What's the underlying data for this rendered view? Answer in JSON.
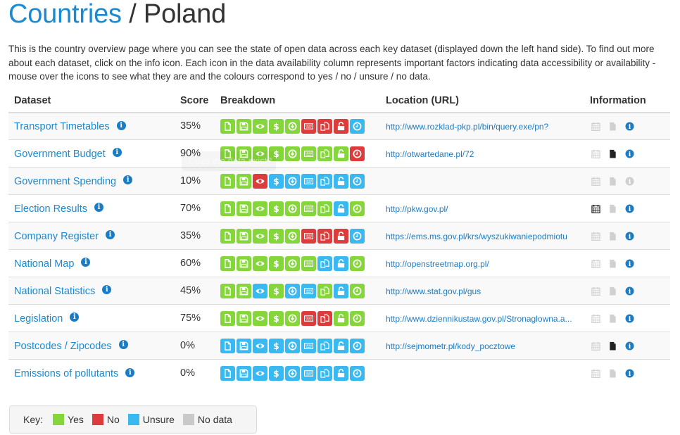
{
  "header": {
    "breadcrumb_link": "Countries",
    "separator": " / ",
    "country": "Poland"
  },
  "intro": "This is the country overview page where you can see the state of open data across each key dataset (displayed down the left hand side). To find out more about each dataset, click on the info icon. Each icon in the data availability column represents important factors indicating data accessibility or availability - mouse over the icons to see what they are and the colours correspond to yes / no / unsure / no data.",
  "columns": [
    "Dataset",
    "Score",
    "Breakdown",
    "Location (URL)",
    "Information"
  ],
  "breakdown_icons": [
    "file-icon",
    "save-icon",
    "eye-icon",
    "dollar-icon",
    "download-icon",
    "keyboard-icon",
    "copy-icon",
    "unlock-icon",
    "clock-icon"
  ],
  "colors": {
    "yes": "#85d63a",
    "no": "#dc3c3c",
    "unsure": "#38b9f2",
    "nodata": "#c9c9c9",
    "link": "#1b8ad1"
  },
  "rows": [
    {
      "name": "Transport Timetables",
      "score": "35%",
      "breakdown": [
        "g",
        "g",
        "g",
        "g",
        "g",
        "r",
        "r",
        "r",
        "b"
      ],
      "url": "http://www.rozklad-pkp.pl/bin/query.exe/pn?",
      "info": {
        "calendar": "off",
        "file": "off",
        "info": "on"
      }
    },
    {
      "name": "Government Budget",
      "score": "90%",
      "breakdown": [
        "g",
        "g",
        "g",
        "g",
        "g",
        "g",
        "g",
        "g",
        "r"
      ],
      "url": "http://otwartedane.pl/72",
      "info": {
        "calendar": "off",
        "file": "on",
        "info": "on"
      }
    },
    {
      "name": "Government Spending",
      "score": "10%",
      "breakdown": [
        "g",
        "g",
        "r",
        "b",
        "b",
        "b",
        "b",
        "b",
        "b"
      ],
      "url": "",
      "info": {
        "calendar": "off",
        "file": "off",
        "info": "off"
      }
    },
    {
      "name": "Election Results",
      "score": "70%",
      "breakdown": [
        "g",
        "g",
        "g",
        "g",
        "g",
        "g",
        "g",
        "b",
        "g"
      ],
      "url": "http://pkw.gov.pl/",
      "info": {
        "calendar": "on",
        "file": "off",
        "info": "on"
      }
    },
    {
      "name": "Company Register",
      "score": "35%",
      "breakdown": [
        "g",
        "g",
        "g",
        "g",
        "g",
        "r",
        "r",
        "r",
        "b"
      ],
      "url": "https://ems.ms.gov.pl/krs/wyszukiwaniepodmiotu",
      "info": {
        "calendar": "off",
        "file": "off",
        "info": "on"
      }
    },
    {
      "name": "National Map",
      "score": "60%",
      "breakdown": [
        "g",
        "g",
        "g",
        "g",
        "g",
        "g",
        "b",
        "b",
        "g"
      ],
      "url": "http://openstreetmap.org.pl/",
      "info": {
        "calendar": "off",
        "file": "off",
        "info": "on"
      }
    },
    {
      "name": "National Statistics",
      "score": "45%",
      "breakdown": [
        "g",
        "g",
        "b",
        "g",
        "b",
        "b",
        "g",
        "b",
        "g"
      ],
      "url": "http://www.stat.gov.pl/gus",
      "info": {
        "calendar": "off",
        "file": "off",
        "info": "on"
      }
    },
    {
      "name": "Legislation",
      "score": "75%",
      "breakdown": [
        "g",
        "g",
        "g",
        "g",
        "g",
        "r",
        "r",
        "g",
        "g"
      ],
      "url": "http://www.dziennikustaw.gov.pl/Stronaglowna.a...",
      "info": {
        "calendar": "off",
        "file": "off",
        "info": "on"
      }
    },
    {
      "name": "Postcodes / Zipcodes",
      "score": "0%",
      "breakdown": [
        "b",
        "b",
        "b",
        "b",
        "b",
        "b",
        "b",
        "b",
        "b"
      ],
      "url": "http://sejmometr.pl/kody_pocztowe",
      "info": {
        "calendar": "off",
        "file": "on",
        "info": "on"
      }
    },
    {
      "name": "Emissions of pollutants",
      "score": "0%",
      "breakdown": [
        "b",
        "b",
        "b",
        "b",
        "b",
        "b",
        "b",
        "b",
        "b"
      ],
      "url": "",
      "info": {
        "calendar": "off",
        "file": "off",
        "info": "on"
      }
    }
  ],
  "tooltip": "Does the data exist?",
  "key": {
    "label": "Key:",
    "items": [
      {
        "label": "Yes",
        "color": "#85d63a"
      },
      {
        "label": "No",
        "color": "#dc3c3c"
      },
      {
        "label": "Unsure",
        "color": "#38b9f2"
      },
      {
        "label": "No data",
        "color": "#c9c9c9"
      }
    ]
  }
}
